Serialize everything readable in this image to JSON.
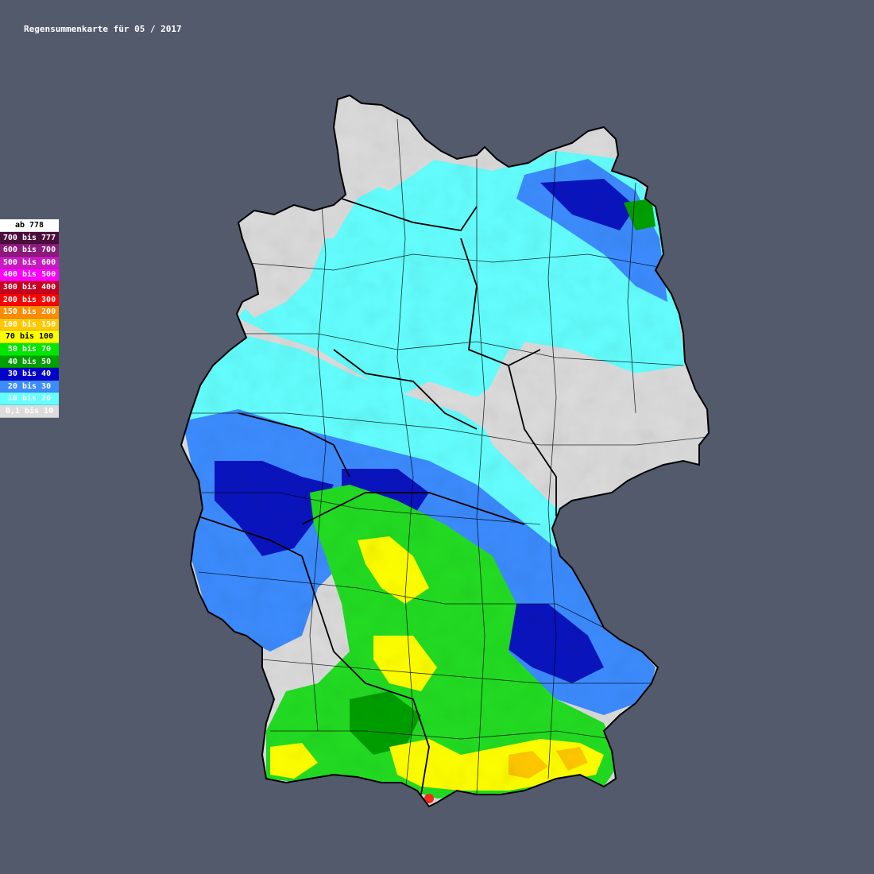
{
  "title": "Regensummenkarte für 05 / 2017",
  "legend": [
    {
      "label": "ab 778",
      "color": "#ffffff",
      "text_color": "#000000"
    },
    {
      "label": "700 bis 777",
      "color": "#4b0d3c",
      "text_color": "#ffffff"
    },
    {
      "label": "600 bis 700",
      "color": "#8b1a7a",
      "text_color": "#ffffff"
    },
    {
      "label": "500 bis 600",
      "color": "#c71bc0",
      "text_color": "#ffffff"
    },
    {
      "label": "400 bis 500",
      "color": "#ff00ff",
      "text_color": "#ffffff"
    },
    {
      "label": "300 bis 400",
      "color": "#c8001e",
      "text_color": "#ffffff"
    },
    {
      "label": "200 bis 300",
      "color": "#ff0000",
      "text_color": "#ffffff"
    },
    {
      "label": "150 bis 200",
      "color": "#ff8c00",
      "text_color": "#ffffff"
    },
    {
      "label": "100 bis 150",
      "color": "#ffc800",
      "text_color": "#ffffff"
    },
    {
      "label": "70 bis 100",
      "color": "#ffff00",
      "text_color": "#000000"
    },
    {
      "label": "50 bis 70",
      "color": "#00e600",
      "text_color": "#ffffff"
    },
    {
      "label": "40 bis 50",
      "color": "#00a000",
      "text_color": "#ffffff"
    },
    {
      "label": "30 bis 40",
      "color": "#0000c8",
      "text_color": "#ffffff"
    },
    {
      "label": "20 bis 30",
      "color": "#3c8cff",
      "text_color": "#ffffff"
    },
    {
      "label": "10 bis 20",
      "color": "#64ffff",
      "text_color": "#ffffff"
    },
    {
      "label": "0,1 bis 10",
      "color": "#dcdcdc",
      "text_color": "#ffffff"
    }
  ],
  "colors": {
    "background": "#535a6c",
    "border": "#000000"
  }
}
